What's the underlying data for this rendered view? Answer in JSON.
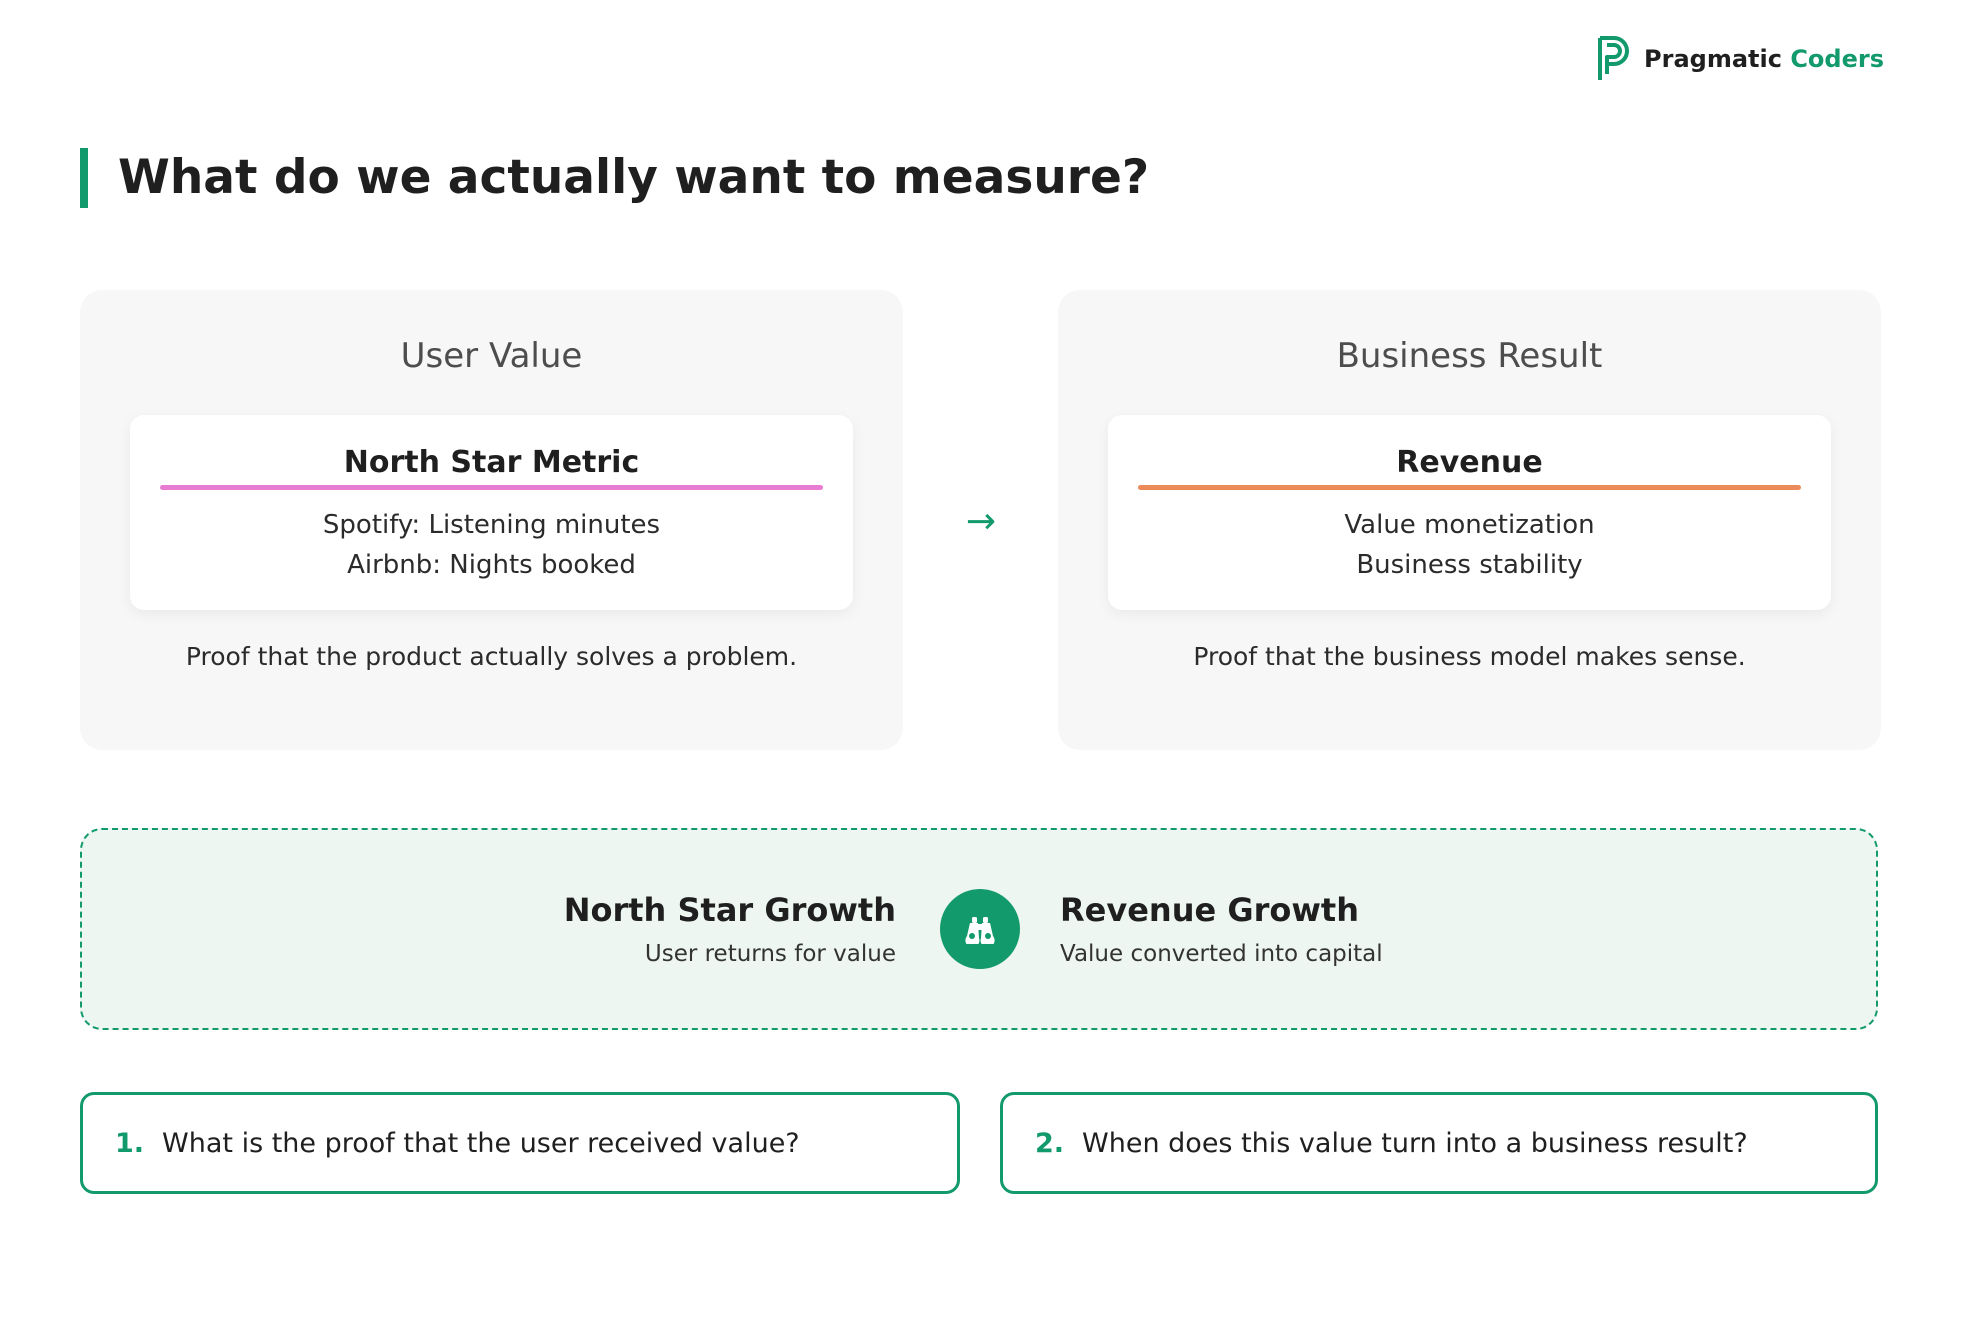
{
  "brand": {
    "name_part1": "Pragmatic",
    "name_part2": "Coders",
    "logo_icon": "pc-logo-icon",
    "accent_color": "#139a6c"
  },
  "page": {
    "title": "What do we actually want to measure?"
  },
  "cards": {
    "left": {
      "heading": "User Value",
      "metric_title": "North Star Metric",
      "underline_color": "#e87bd2",
      "lines": [
        "Spotify: Listening minutes",
        "Airbnb: Nights booked"
      ],
      "caption": "Proof that the product actually solves a problem."
    },
    "right": {
      "heading": "Business Result",
      "metric_title": "Revenue",
      "underline_color": "#ec8a59",
      "lines": [
        "Value monetization",
        "Business stability"
      ],
      "caption": "Proof that the business model makes sense."
    },
    "arrow": "→"
  },
  "growth": {
    "left_title": "North Star Growth",
    "left_sub": "User returns for value",
    "right_title": "Revenue Growth",
    "right_sub": "Value converted into capital",
    "icon": "binoculars-icon"
  },
  "questions": [
    {
      "number": "1.",
      "text": "What is the proof that the user received value?"
    },
    {
      "number": "2.",
      "text": "When does this value turn into a business result?"
    }
  ]
}
